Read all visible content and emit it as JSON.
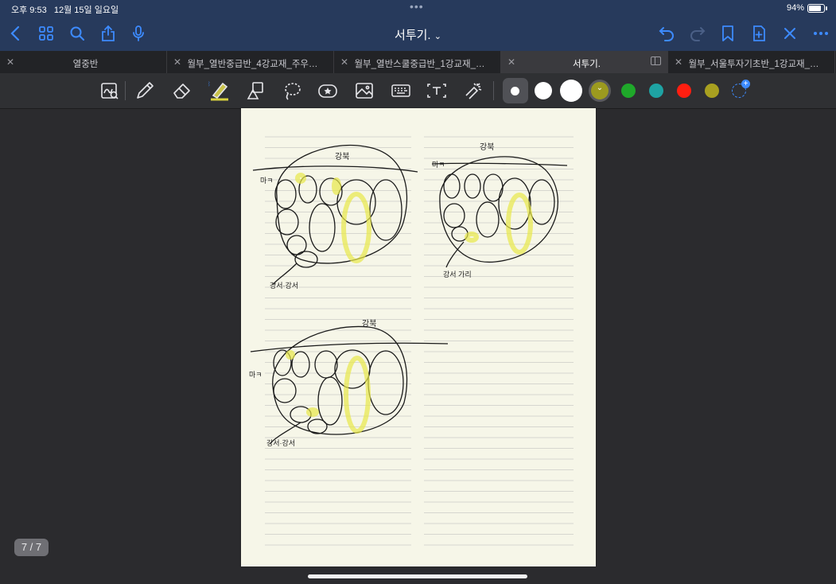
{
  "status_bar": {
    "time": "오후 9:53",
    "date": "12월 15일 일요일",
    "battery": "94%",
    "battery_level": 0.94
  },
  "nav": {
    "title": "서투기.",
    "icons": [
      "back-icon",
      "grid-icon",
      "search-icon",
      "share-icon",
      "mic-icon",
      "undo-icon",
      "redo-icon",
      "bookmark-icon",
      "add-page-icon",
      "close-icon",
      "more-icon"
    ],
    "accent": "#3d8bff"
  },
  "tabs": [
    {
      "label": "열중반",
      "active": false
    },
    {
      "label": "월부_열반중급반_4강교재_주우…",
      "active": false
    },
    {
      "label": "월부_열반스쿨중급반_1강교재_…",
      "active": false
    },
    {
      "label": "서투기.",
      "active": true
    },
    {
      "label": "월부_서울투자기초반_1강교재_…",
      "active": false
    }
  ],
  "toolbar": {
    "tools": [
      "zoom-lasso-icon",
      "pen-icon",
      "eraser-icon",
      "highlighter-icon",
      "shapes-icon",
      "lasso-icon",
      "sticker-icon",
      "image-icon",
      "keyboard-icon",
      "text-box-icon",
      "laser-pointer-icon"
    ],
    "colors": [
      "#ffffff",
      "#ffffff",
      "#ffffff",
      "#9c9a1f",
      "#1fa82a",
      "#1ea3a3",
      "#ff1e10",
      "#a8a020"
    ],
    "selected_color": "#9c9a1f"
  },
  "page": {
    "indicator": "7 / 7",
    "background": "#f6f6e8"
  },
  "sketches": [
    {
      "title": "강북",
      "label_left": "마ㅋ",
      "label_bottom": "강서·강서"
    },
    {
      "title": "강북",
      "label_left": "마ㅋ",
      "label_bottom": "강서 가리"
    },
    {
      "title": "강북",
      "label_left": "마ㅋ",
      "label_bottom": "강서·강서"
    }
  ]
}
